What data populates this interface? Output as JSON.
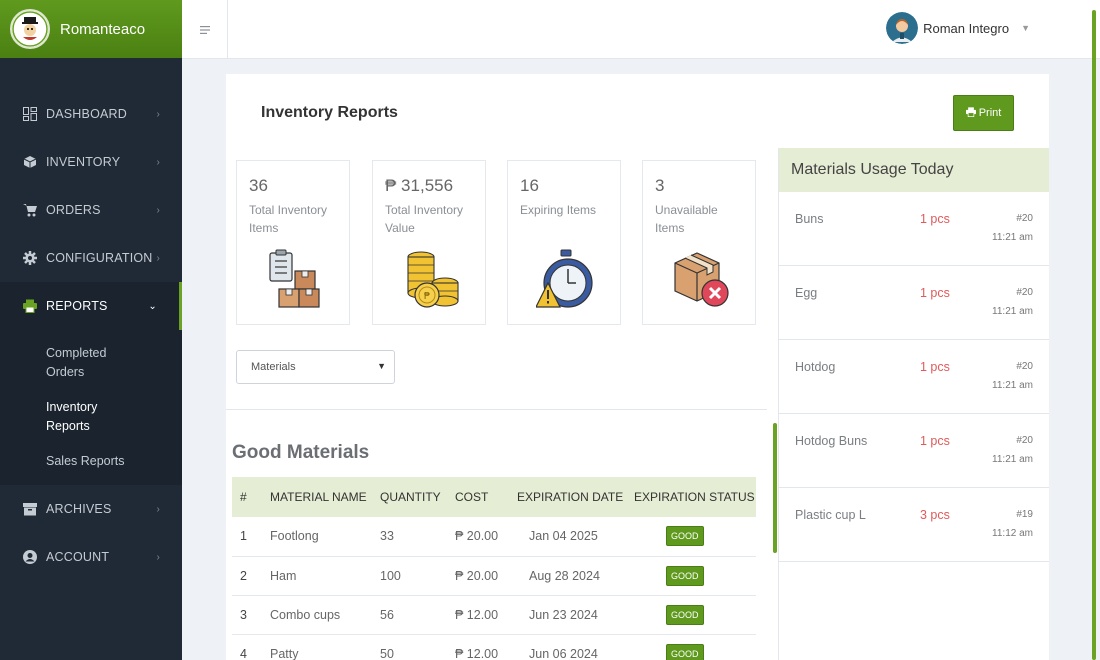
{
  "brand": {
    "name": "Romanteaco"
  },
  "user": {
    "name": "Roman Integro"
  },
  "sidebar": {
    "items": [
      {
        "label": "DASHBOARD"
      },
      {
        "label": "INVENTORY"
      },
      {
        "label": "ORDERS"
      },
      {
        "label": "CONFIGURATION"
      },
      {
        "label": "REPORTS"
      },
      {
        "label": "ARCHIVES"
      },
      {
        "label": "ACCOUNT"
      }
    ],
    "reports_sub": [
      {
        "label": "Completed Orders"
      },
      {
        "label": "Inventory Reports"
      },
      {
        "label": "Sales Reports"
      }
    ]
  },
  "page": {
    "title": "Inventory Reports",
    "print_label": "Print"
  },
  "stats": [
    {
      "value": "36",
      "label": "Total Inventory Items"
    },
    {
      "value": "₱ 31,556",
      "label": "Total Inventory Value"
    },
    {
      "value": "16",
      "label": "Expiring Items"
    },
    {
      "value": "3",
      "label": "Unavailable Items"
    }
  ],
  "filter": {
    "selected": "Materials"
  },
  "table": {
    "title": "Good Materials",
    "headers": [
      "#",
      "MATERIAL NAME",
      "QUANTITY",
      "COST",
      "EXPIRATION DATE",
      "EXPIRATION STATUS"
    ],
    "rows": [
      {
        "no": "1",
        "name": "Footlong",
        "qty": "33",
        "cost": "₱ 20.00",
        "date": "Jan 04 2025",
        "status": "GOOD"
      },
      {
        "no": "2",
        "name": "Ham",
        "qty": "100",
        "cost": "₱ 20.00",
        "date": "Aug 28 2024",
        "status": "GOOD"
      },
      {
        "no": "3",
        "name": "Combo cups",
        "qty": "56",
        "cost": "₱ 12.00",
        "date": "Jun 23 2024",
        "status": "GOOD"
      },
      {
        "no": "4",
        "name": "Patty",
        "qty": "50",
        "cost": "₱ 12.00",
        "date": "Jun 06 2024",
        "status": "GOOD"
      }
    ]
  },
  "usage": {
    "title": "Materials Usage Today",
    "items": [
      {
        "name": "Buns",
        "qty": "1 pcs",
        "ref": "#20",
        "time": "11:21 am"
      },
      {
        "name": "Egg",
        "qty": "1 pcs",
        "ref": "#20",
        "time": "11:21 am"
      },
      {
        "name": "Hotdog",
        "qty": "1 pcs",
        "ref": "#20",
        "time": "11:21 am"
      },
      {
        "name": "Hotdog Buns",
        "qty": "1 pcs",
        "ref": "#20",
        "time": "11:21 am"
      },
      {
        "name": "Plastic cup L",
        "qty": "3 pcs",
        "ref": "#19",
        "time": "11:12 am"
      }
    ]
  },
  "colors": {
    "accent": "#5f9a1e",
    "sidebar": "#1f2a36",
    "table_header": "#e5edd4",
    "danger_text": "#e05a5a"
  }
}
